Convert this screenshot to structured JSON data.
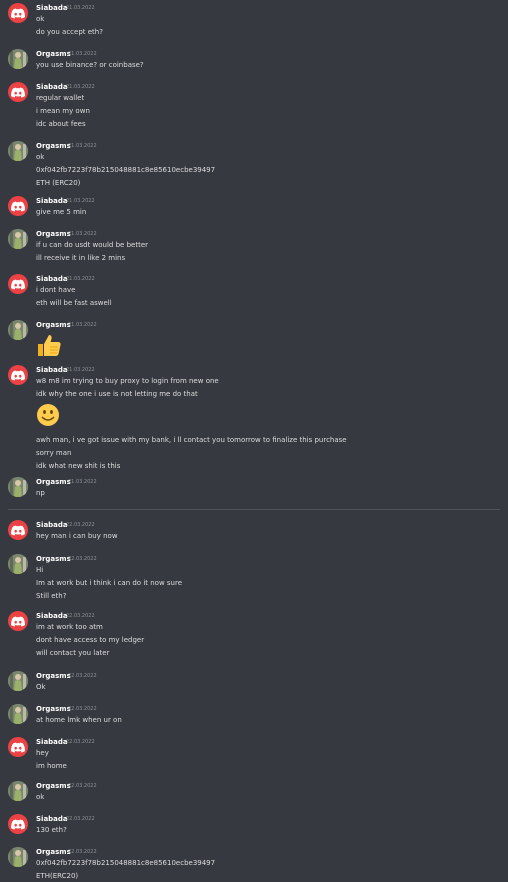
{
  "messages": [
    {
      "author": "Siabada",
      "time": "21.03.2022",
      "lines": [
        "ok",
        "do you accept eth?"
      ]
    },
    {
      "author": "Orgasms",
      "time": "21.03.2022",
      "lines": [
        "you use binance? or coinbase?"
      ]
    },
    {
      "author": "Siabada",
      "time": "21.03.2022",
      "lines": [
        "regular wallet",
        "i mean my own",
        "idc about fees"
      ]
    },
    {
      "author": "Orgasms",
      "time": "21.03.2022",
      "lines": [
        "ok",
        "0xf042fb7223f78b215048881c8e85610ecbe39497",
        "ETH (ERC20)"
      ]
    },
    {
      "author": "Siabada",
      "time": "21.03.2022",
      "lines": [
        "give me 5 min"
      ]
    },
    {
      "author": "Orgasms",
      "time": "21.03.2022",
      "lines": [
        "if u can do usdt would be better",
        "ill receive it in like 2 mins"
      ]
    },
    {
      "author": "Siabada",
      "time": "21.03.2022",
      "lines": [
        "i dont have",
        "eth will be fast aswell"
      ]
    },
    {
      "author": "Orgasms",
      "time": "21.03.2022",
      "lines": [],
      "emoji": "thumbs-up"
    },
    {
      "author": "Siabada",
      "time": "21.03.2022",
      "lines": [
        "w8 m8 im trying to buy proxy to login from new one",
        "idk why the one i use is not letting me do that"
      ],
      "emoji": "smile",
      "lines_after": [
        "awh man, i ve got issue with my bank, i ll contact  you tomorrow to finalize this purchase",
        "sorry man",
        "idk what new shit is this"
      ]
    },
    {
      "author": "Orgasms",
      "time": "21.03.2022",
      "lines": [
        "np"
      ]
    },
    {
      "author": "Siabada",
      "time": "22.03.2022",
      "lines": [
        "hey man i can buy now"
      ]
    },
    {
      "author": "Orgasms",
      "time": "22.03.2022",
      "lines": [
        "Hi",
        "Im at work but i think i can do it now sure",
        "Still eth?"
      ]
    },
    {
      "author": "Siabada",
      "time": "22.03.2022",
      "lines": [
        "im at work too atm",
        "dont have access to my ledger",
        "will contact you later"
      ]
    },
    {
      "author": "Orgasms",
      "time": "22.03.2022",
      "lines": [
        "Ok"
      ]
    },
    {
      "author": "Orgasms",
      "time": "22.03.2022",
      "lines": [
        "at home lmk when ur on"
      ]
    },
    {
      "author": "Siabada",
      "time": "22.03.2022",
      "lines": [
        "hey",
        "im home"
      ]
    },
    {
      "author": "Orgasms",
      "time": "22.03.2022",
      "lines": [
        "ok"
      ]
    },
    {
      "author": "Siabada",
      "time": "22.03.2022",
      "lines": [
        "130 eth?"
      ]
    },
    {
      "author": "Orgasms",
      "time": "22.03.2022",
      "lines": [
        "0xf042fb7223f78b215048881c8e85610ecbe39497",
        "ETH(ERC20)"
      ]
    }
  ],
  "colors": {
    "background": "#36393f",
    "discord_red": "#ed4245",
    "username": "#ffffff",
    "timestamp": "#8e9297",
    "text": "#dcddde"
  }
}
